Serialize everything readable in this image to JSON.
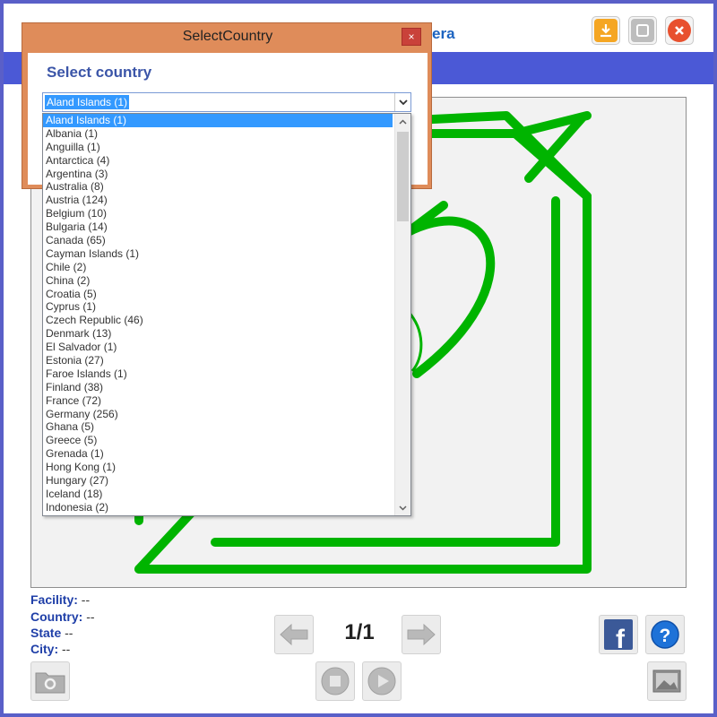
{
  "app": {
    "title_fragment": "era"
  },
  "dialog": {
    "title": "SelectCountry",
    "close_glyph": "×",
    "heading": "Select country",
    "selected_value": "Aland Islands (1)",
    "countries": [
      "Aland Islands (1)",
      "Albania (1)",
      "Anguilla (1)",
      "Antarctica (4)",
      "Argentina (3)",
      "Australia (8)",
      "Austria (124)",
      "Belgium (10)",
      "Bulgaria (14)",
      "Canada (65)",
      "Cayman Islands (1)",
      "Chile (2)",
      "China (2)",
      "Croatia (5)",
      "Cyprus (1)",
      "Czech Republic (46)",
      "Denmark (13)",
      "El Salvador (1)",
      "Estonia (27)",
      "Faroe Islands (1)",
      "Finland (38)",
      "France (72)",
      "Germany (256)",
      "Ghana (5)",
      "Greece (5)",
      "Grenada (1)",
      "Hong Kong (1)",
      "Hungary (27)",
      "Iceland (18)",
      "Indonesia (2)"
    ],
    "highlighted_index": 0
  },
  "info": {
    "facility_label": "Facility:",
    "facility_value": "--",
    "country_label": "Country:",
    "country_value": "--",
    "state_label": "State",
    "state_value": "--",
    "city_label": "City:",
    "city_value": "--"
  },
  "pager": {
    "current": "1/1"
  },
  "colors": {
    "titlebar_blue": "#4b59d6",
    "dialog_orange": "#df8c5a",
    "selection_blue": "#3399ff",
    "image_green": "#00b400"
  },
  "icons": {
    "download": "download-icon",
    "maximize": "maximize-icon",
    "close": "close-icon",
    "back": "arrow-left-icon",
    "forward": "arrow-right-icon",
    "facebook": "facebook-icon",
    "help": "help-icon",
    "settings_folder": "folder-settings-icon",
    "stop": "stop-icon",
    "play": "play-icon",
    "image": "image-icon"
  }
}
